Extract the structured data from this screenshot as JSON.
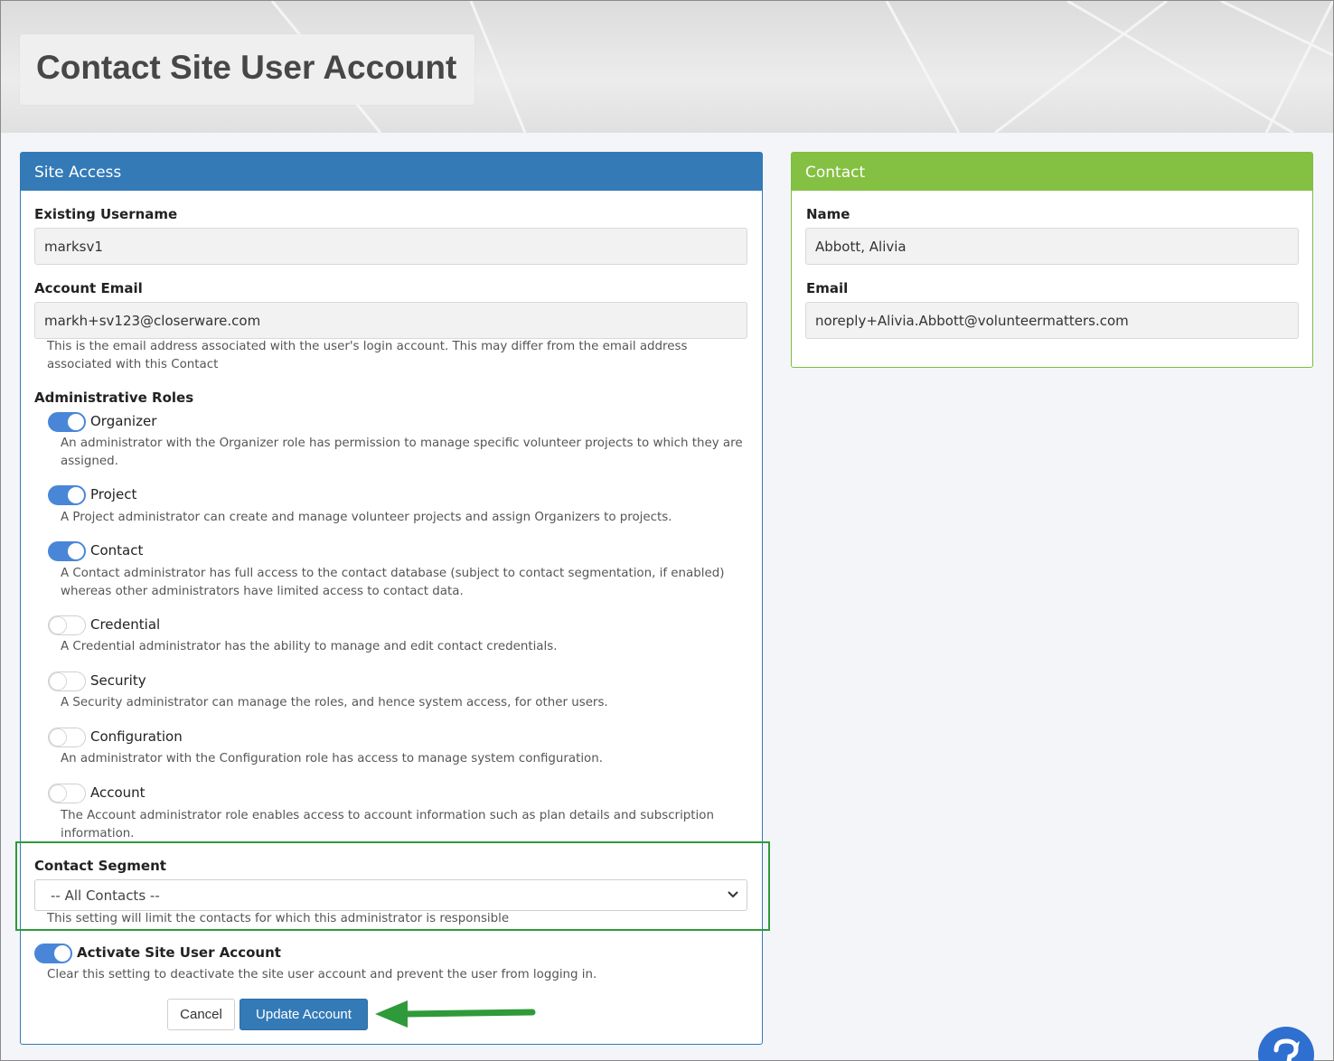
{
  "page": {
    "title": "Contact Site User Account"
  },
  "site_access": {
    "heading": "Site Access",
    "username_label": "Existing Username",
    "username_value": "marksv1",
    "email_label": "Account Email",
    "email_value": "markh+sv123@closerware.com",
    "email_help_1": "This is the email address associated with the user's login account. This may differ from the email address",
    "email_help_2": "associated with this Contact",
    "roles_label": "Administrative Roles",
    "roles": [
      {
        "name": "Organizer",
        "enabled": true,
        "desc_1": "An administrator with the Organizer role has permission to manage specific volunteer projects to which they are",
        "desc_2": "assigned."
      },
      {
        "name": "Project",
        "enabled": true,
        "desc_1": "A Project administrator can create and manage volunteer projects and assign Organizers to projects.",
        "desc_2": ""
      },
      {
        "name": "Contact",
        "enabled": true,
        "desc_1": "A Contact administrator has full access to the contact database (subject to contact segmentation, if enabled)",
        "desc_2": "whereas other administrators have limited access to contact data."
      },
      {
        "name": "Credential",
        "enabled": false,
        "desc_1": "A Credential administrator has the ability to manage and edit contact credentials.",
        "desc_2": ""
      },
      {
        "name": "Security",
        "enabled": false,
        "desc_1": "A Security administrator can manage the roles, and hence system access, for other users.",
        "desc_2": ""
      },
      {
        "name": "Configuration",
        "enabled": false,
        "desc_1": "An administrator with the Configuration role has access to manage system configuration.",
        "desc_2": ""
      },
      {
        "name": "Account",
        "enabled": false,
        "desc_1": "The Account administrator role enables access to account information such as plan details and subscription",
        "desc_2": "information."
      }
    ],
    "segment_label": "Contact Segment",
    "segment_value": "-- All Contacts --",
    "segment_help": "This setting will limit the contacts for which this administrator is responsible",
    "activate_label": "Activate Site User Account",
    "activate_enabled": true,
    "activate_help": "Clear this setting to deactivate the site user account and prevent the user from logging in.",
    "cancel_label": "Cancel",
    "update_label": "Update Account"
  },
  "contact": {
    "heading": "Contact",
    "name_label": "Name",
    "name_value": "Abbott, Alivia",
    "email_label": "Email",
    "email_value": "noreply+Alivia.Abbott@volunteermatters.com"
  },
  "colors": {
    "site_access_header": "#337ab7",
    "contact_header": "#84c042",
    "annotation": "#2e9a3a",
    "toggle_on": "#4a86d8"
  }
}
